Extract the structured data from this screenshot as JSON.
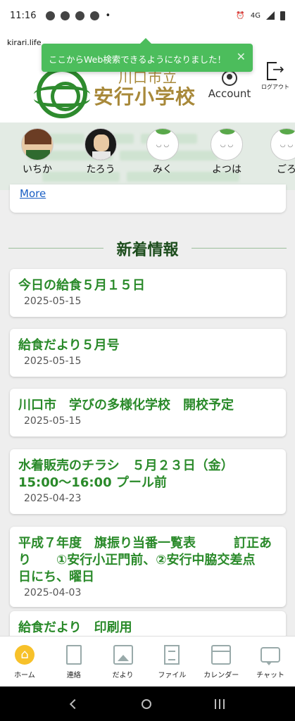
{
  "status_bar": {
    "time": "11:16",
    "network": "4G"
  },
  "url": "kirari.life",
  "toast": {
    "message": "ここからWeb検索できるようになりました！",
    "close": "✕"
  },
  "header": {
    "school_sub": "川口市立",
    "school_name": "安行小学校",
    "account_label": "Account",
    "logout_label": "ログアウト"
  },
  "characters": [
    {
      "name": "いちか",
      "icon": "girl-avatar"
    },
    {
      "name": "たろう",
      "icon": "boy-avatar"
    },
    {
      "name": "みく",
      "icon": "sheep-avatar"
    },
    {
      "name": "よつは",
      "icon": "sheep-avatar"
    },
    {
      "name": "ごろ",
      "icon": "sheep-avatar"
    }
  ],
  "more_link": "More",
  "news_section": {
    "title": "新着情報",
    "items": [
      {
        "title": "今日の給食５月１５日",
        "date": "2025-05-15"
      },
      {
        "title": "給食だより５月号",
        "date": "2025-05-15"
      },
      {
        "title": "川口市　学びの多様化学校　開校予定",
        "date": "2025-05-15"
      },
      {
        "title": "水着販売のチラシ　５月２３日（金）15:00〜16:00 プール前",
        "date": "2025-04-23"
      },
      {
        "title": "平成７年度　旗振り当番一覧表　　　訂正あり　　①安行小正門前、②安行中脇交差点　日にち、曜日",
        "date": "2025-04-03"
      },
      {
        "title": "給食だより　印刷用",
        "date": ""
      }
    ]
  },
  "bottom_nav": [
    {
      "label": "ホーム",
      "icon": "home-icon"
    },
    {
      "label": "連絡",
      "icon": "notebook-icon"
    },
    {
      "label": "だより",
      "icon": "image-icon"
    },
    {
      "label": "ファイル",
      "icon": "file-icon"
    },
    {
      "label": "カレンダー",
      "icon": "calendar-icon"
    },
    {
      "label": "チャット",
      "icon": "chat-icon"
    }
  ],
  "colors": {
    "accent_green": "#2a8a2a",
    "toast_green": "#4cbd5c",
    "school_gold": "#a8893a",
    "home_yellow": "#f7c12a"
  }
}
